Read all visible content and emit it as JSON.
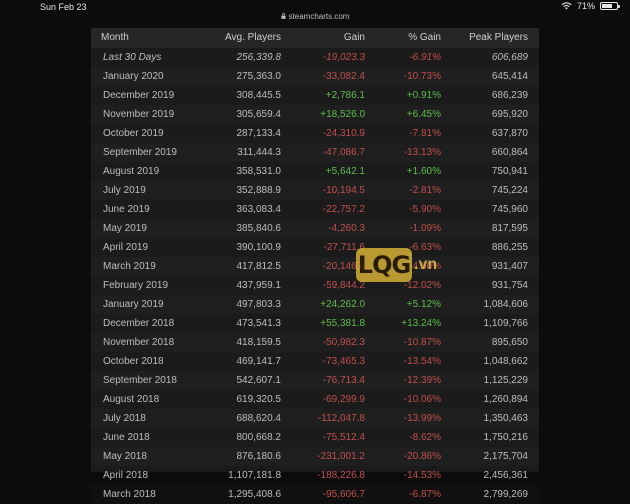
{
  "status": {
    "time": "Sun Feb 23",
    "battery": "71%",
    "battery_level": 0.71
  },
  "browser": {
    "url": "steamcharts.com"
  },
  "table": {
    "headers": {
      "month": "Month",
      "avg": "Avg. Players",
      "gain": "Gain",
      "pct": "% Gain",
      "peak": "Peak Players"
    },
    "rows": [
      {
        "month": "Last 30 Days",
        "avg": "256,339.8",
        "gain": "-19,023.3",
        "pct": "-6.91%",
        "peak": "606,689"
      },
      {
        "month": "January 2020",
        "avg": "275,363.0",
        "gain": "-33,082.4",
        "pct": "-10.73%",
        "peak": "645,414"
      },
      {
        "month": "December 2019",
        "avg": "308,445.5",
        "gain": "+2,786.1",
        "pct": "+0.91%",
        "peak": "686,239"
      },
      {
        "month": "November 2019",
        "avg": "305,659.4",
        "gain": "+18,526.0",
        "pct": "+6.45%",
        "peak": "695,920"
      },
      {
        "month": "October 2019",
        "avg": "287,133.4",
        "gain": "-24,310.9",
        "pct": "-7.81%",
        "peak": "637,870"
      },
      {
        "month": "September 2019",
        "avg": "311,444.3",
        "gain": "-47,086.7",
        "pct": "-13.13%",
        "peak": "660,864"
      },
      {
        "month": "August 2019",
        "avg": "358,531.0",
        "gain": "+5,642.1",
        "pct": "+1.60%",
        "peak": "750,941"
      },
      {
        "month": "July 2019",
        "avg": "352,888.9",
        "gain": "-10,194.5",
        "pct": "-2.81%",
        "peak": "745,224"
      },
      {
        "month": "June 2019",
        "avg": "363,083.4",
        "gain": "-22,757.2",
        "pct": "-5.90%",
        "peak": "745,960"
      },
      {
        "month": "May 2019",
        "avg": "385,840.6",
        "gain": "-4,260.3",
        "pct": "-1.09%",
        "peak": "817,595"
      },
      {
        "month": "April 2019",
        "avg": "390,100.9",
        "gain": "-27,711.6",
        "pct": "-6.63%",
        "peak": "886,255"
      },
      {
        "month": "March 2019",
        "avg": "417,812.5",
        "gain": "-20,146.6",
        "pct": "-4.60%",
        "peak": "931,407"
      },
      {
        "month": "February 2019",
        "avg": "437,959.1",
        "gain": "-59,844.2",
        "pct": "-12.02%",
        "peak": "931,754"
      },
      {
        "month": "January 2019",
        "avg": "497,803.3",
        "gain": "+24,262.0",
        "pct": "+5.12%",
        "peak": "1,084,606"
      },
      {
        "month": "December 2018",
        "avg": "473,541.3",
        "gain": "+55,381.8",
        "pct": "+13.24%",
        "peak": "1,109,766"
      },
      {
        "month": "November 2018",
        "avg": "418,159.5",
        "gain": "-50,982.3",
        "pct": "-10.87%",
        "peak": "895,650"
      },
      {
        "month": "October 2018",
        "avg": "469,141.7",
        "gain": "-73,465.3",
        "pct": "-13.54%",
        "peak": "1,048,662"
      },
      {
        "month": "September 2018",
        "avg": "542,607.1",
        "gain": "-76,713.4",
        "pct": "-12.39%",
        "peak": "1,125,229"
      },
      {
        "month": "August 2018",
        "avg": "619,320.5",
        "gain": "-69,299.9",
        "pct": "-10.06%",
        "peak": "1,260,894"
      },
      {
        "month": "July 2018",
        "avg": "688,620.4",
        "gain": "-112,047.8",
        "pct": "-13.99%",
        "peak": "1,350,463"
      },
      {
        "month": "June 2018",
        "avg": "800,668.2",
        "gain": "-75,512.4",
        "pct": "-8.62%",
        "peak": "1,750,216"
      },
      {
        "month": "May 2018",
        "avg": "876,180.6",
        "gain": "-231,001.2",
        "pct": "-20.86%",
        "peak": "2,175,704"
      },
      {
        "month": "April 2018",
        "avg": "1,107,181.8",
        "gain": "-188,226.8",
        "pct": "-14.53%",
        "peak": "2,456,361"
      },
      {
        "month": "March 2018",
        "avg": "1,295,408.6",
        "gain": "-95,606.7",
        "pct": "-6.87%",
        "peak": "2,799,269"
      }
    ]
  },
  "watermark": {
    "brand": "LQG",
    "suffix": ".vn"
  },
  "colors": {
    "negative": "#c0504d",
    "positive": "#5cbf4a",
    "panel": "#1b1b1b",
    "header": "#262626"
  }
}
